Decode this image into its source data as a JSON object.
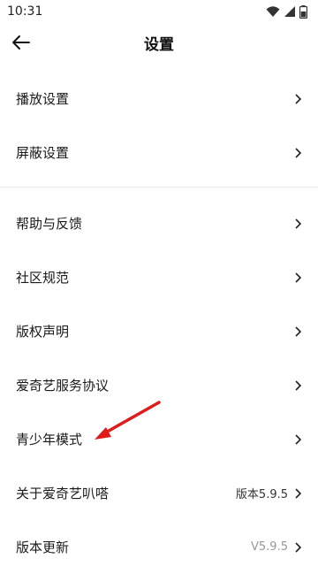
{
  "status_bar": {
    "time": "10:31",
    "icons": [
      "wifi-icon",
      "signal-icon",
      "battery-icon"
    ]
  },
  "header": {
    "back_icon": "back-arrow-icon",
    "title": "设置"
  },
  "section1": [
    {
      "label": "播放设置"
    },
    {
      "label": "屏蔽设置"
    }
  ],
  "section2": [
    {
      "label": "帮助与反馈"
    },
    {
      "label": "社区规范"
    },
    {
      "label": "版权声明"
    },
    {
      "label": "爱奇艺服务协议"
    },
    {
      "label": "青少年模式"
    },
    {
      "label": "关于爱奇艺叭嗒",
      "value": "版本5.9.5"
    },
    {
      "label": "版本更新",
      "value": "V5.9.5"
    }
  ],
  "colors": {
    "annotation_arrow": "#e01b1b",
    "divider": "#ececec",
    "muted_value": "#999999"
  }
}
